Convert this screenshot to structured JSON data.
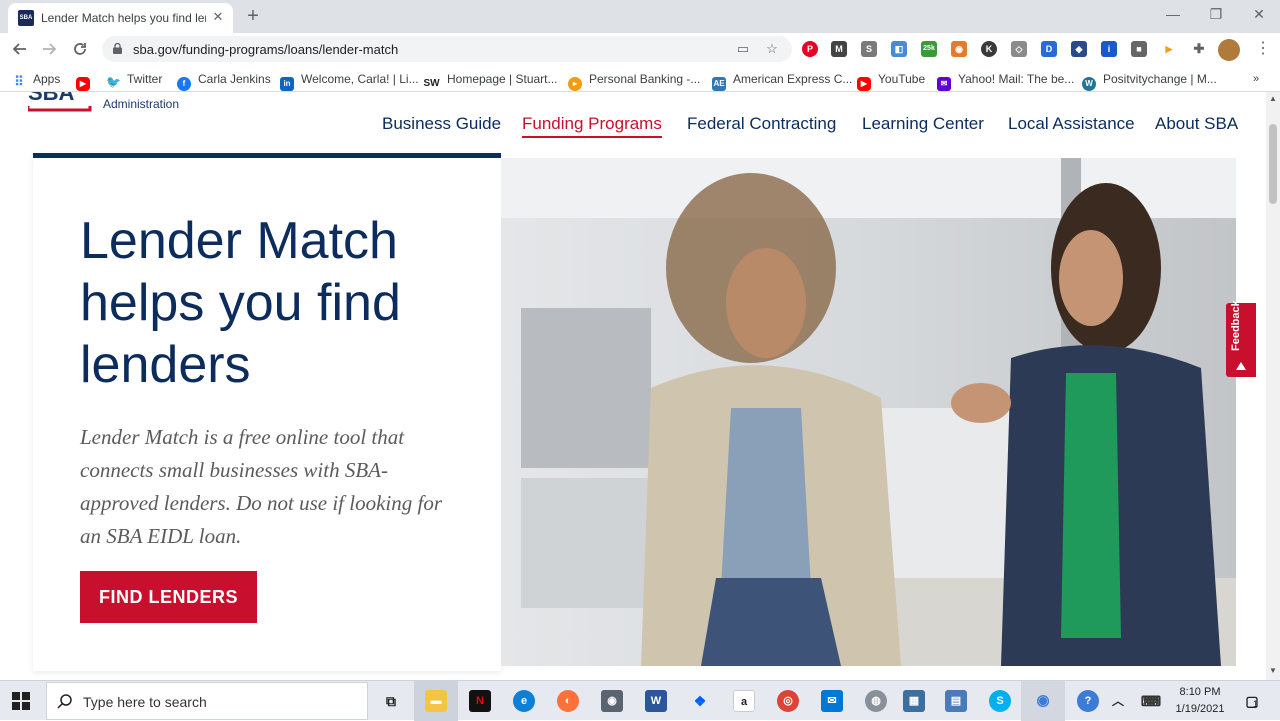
{
  "browser": {
    "tab_title": "Lender Match helps you find lenders",
    "tab_favicon": "SBA",
    "new_tab_symbol": "+",
    "url": "sba.gov/funding-programs/loans/lender-match",
    "window_controls": {
      "minimize": "—",
      "maximize": "❐",
      "close": "✕"
    }
  },
  "extensions": [
    {
      "name": "pinterest-extension-icon",
      "label": "P",
      "color": "#e60023"
    },
    {
      "name": "m-extension-icon",
      "label": "M",
      "color": "#444444"
    },
    {
      "name": "s-extension-icon",
      "label": "S",
      "color": "#7a7a7a"
    },
    {
      "name": "clip-extension-icon",
      "label": "◧",
      "color": "#4a88d8"
    },
    {
      "name": "25k-extension-icon",
      "label": "25k",
      "color": "#3a9a3a"
    },
    {
      "name": "camera-extension-icon",
      "label": "◉",
      "color": "#e57a2a"
    },
    {
      "name": "k-extension-icon",
      "label": "K",
      "color": "#3a3a3a"
    },
    {
      "name": "shield-extension-icon",
      "label": "◇",
      "color": "#8a8a8a"
    },
    {
      "name": "d-extension-icon",
      "label": "D",
      "color": "#2a6ad8"
    },
    {
      "name": "person-extension-icon",
      "label": "◆",
      "color": "#2a4a8a"
    },
    {
      "name": "info-extension-icon",
      "label": "i",
      "color": "#1a5ac8"
    },
    {
      "name": "square-extension-icon",
      "label": "■",
      "color": "#666666"
    },
    {
      "name": "play-extension-icon",
      "label": "▶",
      "color": "#f0a020"
    },
    {
      "name": "puzzle-extension-icon",
      "label": "✚",
      "color": "#5f6368"
    }
  ],
  "bookmarks": [
    {
      "label": "Apps",
      "icon": "apps-grid-icon",
      "color": "#4285f4"
    },
    {
      "label": "",
      "icon": "youtube-icon",
      "color": "#ff0000"
    },
    {
      "label": "Twitter",
      "icon": "twitter-icon",
      "color": "#1da1f2"
    },
    {
      "label": "Carla Jenkins",
      "icon": "facebook-icon",
      "color": "#1877f2"
    },
    {
      "label": "Welcome, Carla! | Li...",
      "icon": "linkedin-icon",
      "color": "#0a66c2"
    },
    {
      "label": "Homepage | Stuart...",
      "icon": "sw-icon",
      "color": "#222222"
    },
    {
      "label": "Personal Banking -...",
      "icon": "banking-icon",
      "color": "#f39c12"
    },
    {
      "label": "American Express C...",
      "icon": "amex-icon",
      "color": "#2e77bb"
    },
    {
      "label": "YouTube",
      "icon": "youtube-icon",
      "color": "#ff0000"
    },
    {
      "label": "Yahoo! Mail: The be...",
      "icon": "yahoo-mail-icon",
      "color": "#6001d2"
    },
    {
      "label": "Positvitychange | M...",
      "icon": "wordpress-icon",
      "color": "#21759b"
    }
  ],
  "page": {
    "logo_text": "SBA",
    "logo_subtitle": "Administration",
    "nav": [
      {
        "label": "Business Guide",
        "active": false
      },
      {
        "label": "Funding Programs",
        "active": true
      },
      {
        "label": "Federal Contracting",
        "active": false
      },
      {
        "label": "Learning Center",
        "active": false
      },
      {
        "label": "Local Assistance",
        "active": false
      },
      {
        "label": "About SBA",
        "active": false
      }
    ],
    "hero_title": "Lender Match helps you find lenders",
    "hero_text": "Lender Match is a free online tool that connects small businesses with SBA-approved lenders. Do not use if looking for an SBA EIDL loan.",
    "cta_label": "FIND LENDERS",
    "feedback_label": "Feedback",
    "colors": {
      "navy": "#0b2c5c",
      "red": "#c8102e"
    }
  },
  "taskbar": {
    "search_placeholder": "Type here to search",
    "time": "8:10 PM",
    "date": "1/19/2021",
    "notification_count": "1"
  }
}
